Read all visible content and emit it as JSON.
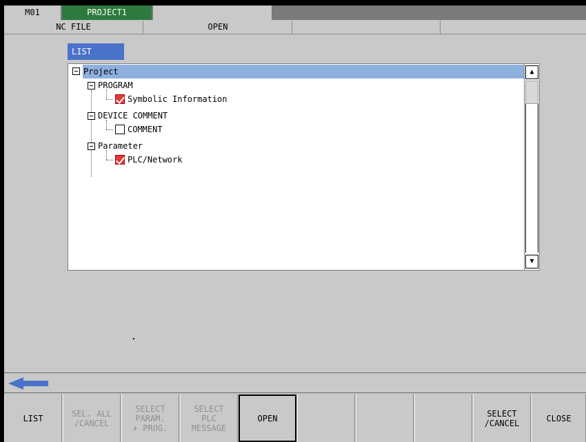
{
  "status": {
    "mode": "M01",
    "project": "PROJECT1"
  },
  "menu": {
    "title": "NC FILE",
    "command": "OPEN"
  },
  "list_tab": "LIST",
  "tree": {
    "root": "Project",
    "items": [
      {
        "label": "PROGRAM",
        "child": {
          "label": "Symbolic Information",
          "checked": true
        }
      },
      {
        "label": "DEVICE COMMENT",
        "child": {
          "label": "COMMENT",
          "checked": false
        }
      },
      {
        "label": "Parameter",
        "child": {
          "label": "PLC/Network",
          "checked": true
        }
      }
    ]
  },
  "scrollbar": {
    "up": "▲",
    "down": "▼"
  },
  "function_keys": [
    {
      "label": "LIST",
      "enabled": true
    },
    {
      "label": "SEL. ALL\n/CANCEL",
      "enabled": false
    },
    {
      "label": "SELECT\nPARAM.\n+ PROG.",
      "enabled": false
    },
    {
      "label": "SELECT\nPLC\nMESSAGE",
      "enabled": false
    },
    {
      "label": "OPEN",
      "enabled": true,
      "active": true
    },
    {
      "label": "",
      "enabled": false
    },
    {
      "label": "",
      "enabled": false
    },
    {
      "label": "",
      "enabled": false
    },
    {
      "label": "SELECT\n/CANCEL",
      "enabled": true
    },
    {
      "label": "CLOSE",
      "enabled": true
    }
  ],
  "colors": {
    "project_bg": "#2e7a3e",
    "list_tab_bg": "#4a72c8",
    "selection_bg": "#8fb0de",
    "check_red": "#e23a3a",
    "back_arrow": "#4a72c8"
  }
}
